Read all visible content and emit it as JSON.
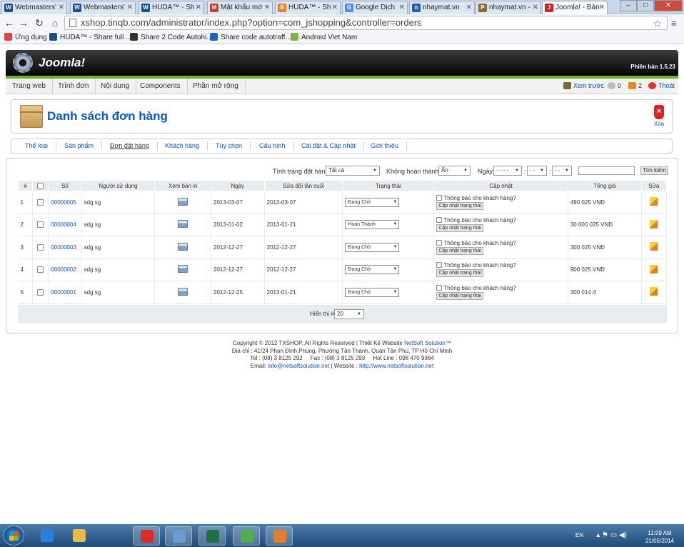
{
  "browser": {
    "tabs": [
      {
        "label": "Webmasters'",
        "fav": "W",
        "color": "#1c4f8c",
        "active": false
      },
      {
        "label": "Webmasters'",
        "fav": "W",
        "color": "#1c4f8c",
        "active": false
      },
      {
        "label": "HUDA™ - Sh",
        "fav": "W",
        "color": "#1c4f8c",
        "active": false
      },
      {
        "label": "Mật khẩu mớ",
        "fav": "M",
        "color": "#c23b22",
        "active": false
      },
      {
        "label": "HUDA™ - Sh",
        "fav": "B",
        "color": "#ee7b25",
        "active": false
      },
      {
        "label": "Google Dịch",
        "fav": "G",
        "color": "#4b8cf5",
        "active": false
      },
      {
        "label": "nhaymat.vn",
        "fav": "n",
        "color": "#2a5db0",
        "active": false
      },
      {
        "label": "nhaymat.vn -",
        "fav": "P",
        "color": "#8a6b2e",
        "active": false
      },
      {
        "label": "Joomla! - Bản",
        "fav": "J",
        "color": "#c22",
        "active": true
      }
    ],
    "url": "xshop.tinqb.com/administrator/index.php?option=com_jshopping&controller=orders",
    "bookmarks": [
      {
        "label": "Ứng dụng",
        "color": "#d44"
      },
      {
        "label": "HUDA™ - Share full ...",
        "color": "#1c4f8c"
      },
      {
        "label": "Share 2 Code Autohi...",
        "color": "#333"
      },
      {
        "label": "Share code autotraff...",
        "color": "#1c63c7"
      },
      {
        "label": "Android Viet Nam",
        "color": "#7cb342"
      }
    ]
  },
  "joomla": {
    "logo": "Joomla!",
    "version": "Phiên bản 1.5.23",
    "menu": [
      "Trang web",
      "Trình đơn",
      "Nội dung",
      "Components",
      "Phần mở rộng"
    ],
    "status": {
      "preview": "Xem trước",
      "messages": "0",
      "users": "2",
      "logout": "Thoát"
    }
  },
  "toolbar": {
    "title": "Danh sách đơn hàng",
    "delete_label": "Xóa"
  },
  "submenu": [
    {
      "label": "Thể loại",
      "active": false
    },
    {
      "label": "Sản phẩm",
      "active": false
    },
    {
      "label": "Đơn đặt hàng",
      "active": true
    },
    {
      "label": "Khách hàng",
      "active": false
    },
    {
      "label": "Tùy chọn",
      "active": false
    },
    {
      "label": "Cấu hình",
      "active": false
    },
    {
      "label": "Cài đặt & Cập nhật",
      "active": false
    },
    {
      "label": "Giới thiệu",
      "active": false
    }
  ],
  "filters": {
    "status_label": "Tình trạng đặt hàng:",
    "status_value": "Tất cả",
    "incomplete_label": "Không hoàn thành:",
    "incomplete_value": "Ẩn",
    "date_label": "Ngày:",
    "date_year": "- - - -",
    "date_month": "- -",
    "date_day": "- -",
    "search_button": "Tìm kiếm"
  },
  "table": {
    "headers": [
      "#",
      "",
      "Số",
      "Người sử dụng",
      "Xem bản in",
      "Ngày",
      "Sửa đổi lần cuối",
      "Trạng thái",
      "Cập nhật",
      "Tổng giá",
      "Sửa"
    ],
    "notify_label": "Thông báo cho khách hàng?",
    "update_button": "Cập nhật trạng thái",
    "rows": [
      {
        "num": "1",
        "order": "00000005",
        "user": "sdg sg",
        "date": "2013-03-07",
        "modified": "2013-03-07",
        "status": "Đang Chờ",
        "total": "490 025 VNĐ"
      },
      {
        "num": "2",
        "order": "00000004",
        "user": "sdg sg",
        "date": "2013-01-02",
        "modified": "2013-01-21",
        "status": "Hoàn Thành",
        "total": "30 000 025 VNĐ"
      },
      {
        "num": "3",
        "order": "00000003",
        "user": "sdg sg",
        "date": "2012-12-27",
        "modified": "2012-12-27",
        "status": "Đang Chờ",
        "total": "300 025 VNĐ"
      },
      {
        "num": "4",
        "order": "00000002",
        "user": "sdg sg",
        "date": "2012-12-27",
        "modified": "2012-12-27",
        "status": "Đang Chờ",
        "total": "900 025 VNĐ"
      },
      {
        "num": "5",
        "order": "00000001",
        "user": "sdg sg",
        "date": "2012-12-25",
        "modified": "2013-01-21",
        "status": "Đang Chờ",
        "total": "300 014 đ"
      }
    ],
    "display_label": "Hiển thị #",
    "display_value": "20"
  },
  "footer": {
    "line1_prefix": "Copyright © 2012 TXSHOP. All Rights Reserved | Thiết Kế Website ",
    "line1_link": "NetSoft Solution™",
    "line2": "Địa chỉ : 41/24 Phan Đình Phùng, Phường Tân Thành, Quận Tân Phú, TP Hồ Chí Minh",
    "line3": "Tel : (08) 3 8125 292     Fax : (08) 3 8125 293     Hot Line : 098 470 9364",
    "line4_prefix": "Email: ",
    "email": "info@netsoftsolution.net",
    "line4_mid": " | Website : ",
    "website": "http://www.netsoftsolution.net"
  },
  "taskbar": {
    "apps": [
      {
        "name": "ie-icon",
        "color": "#2b7de0"
      },
      {
        "name": "explorer-icon",
        "color": "#e8b84a"
      },
      {
        "name": "chrome-icon",
        "color": "#d93025"
      },
      {
        "name": "app-window-icon",
        "color": "#6c9bd2"
      },
      {
        "name": "excel-icon",
        "color": "#1e7145"
      },
      {
        "name": "tool-icon",
        "color": "#4caf50"
      },
      {
        "name": "paint-icon",
        "color": "#e57e2a"
      }
    ],
    "lang": "EN",
    "time": "11:59 AM",
    "date": "21/05/2014"
  }
}
